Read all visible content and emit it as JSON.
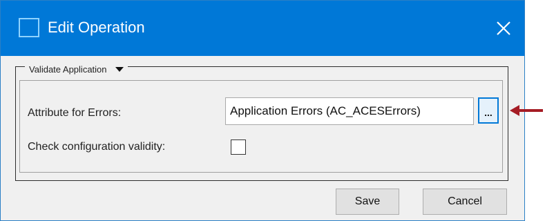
{
  "window": {
    "title": "Edit Operation"
  },
  "group": {
    "label": "Validate Application"
  },
  "fields": {
    "attribute_label": "Attribute for Errors:",
    "attribute_value": "Application Errors (AC_ACESErrors)",
    "browse_label": "...",
    "check_label": "Check configuration validity:",
    "check_value": false
  },
  "buttons": {
    "save": "Save",
    "cancel": "Cancel"
  },
  "colors": {
    "titlebar": "#0078d7",
    "annotation_arrow": "#a51c24"
  }
}
